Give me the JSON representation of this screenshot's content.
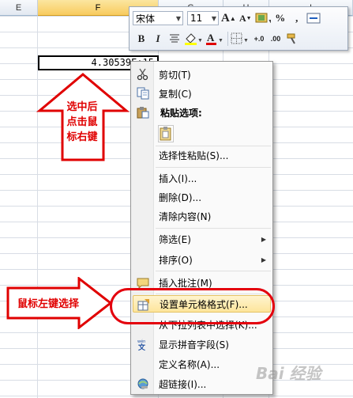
{
  "sheet": {
    "columns": [
      "E",
      "F",
      "G",
      "H",
      "I"
    ],
    "selected_column": "F",
    "active_cell_value": "4.30539E+15"
  },
  "mini_toolbar": {
    "font_name": "宋体",
    "font_size": "11",
    "percent": "%",
    "comma": ","
  },
  "context_menu": {
    "items": [
      {
        "label": "剪切(T)",
        "icon": "scissors-icon"
      },
      {
        "label": "复制(C)",
        "icon": "copy-icon"
      },
      {
        "label": "粘贴选项:",
        "icon": "paste-icon"
      },
      {
        "label": "选择性粘贴(S)..."
      },
      {
        "label": "插入(I)..."
      },
      {
        "label": "删除(D)..."
      },
      {
        "label": "清除内容(N)"
      },
      {
        "label": "筛选(E)",
        "submenu": true
      },
      {
        "label": "排序(O)",
        "submenu": true
      },
      {
        "label": "插入批注(M)",
        "icon": "comment-icon"
      },
      {
        "label": "设置单元格格式(F)...",
        "icon": "format-cells-icon",
        "highlighted": true
      },
      {
        "label": "从下拉列表中选择(K)..."
      },
      {
        "label": "显示拼音字段(S)",
        "icon": "phonetic-icon"
      },
      {
        "label": "定义名称(A)..."
      },
      {
        "label": "超链接(I)...",
        "icon": "hyperlink-icon"
      }
    ]
  },
  "annotations": {
    "up_arrow_text": [
      "选中后",
      "点击鼠",
      "标右键"
    ],
    "right_arrow_text": "鼠标左键选择",
    "watermark": "Bai 经验"
  },
  "colors": {
    "annotation_red": "#e00000",
    "highlight": "#fde59b",
    "header_selected": "#f8cb5e"
  }
}
